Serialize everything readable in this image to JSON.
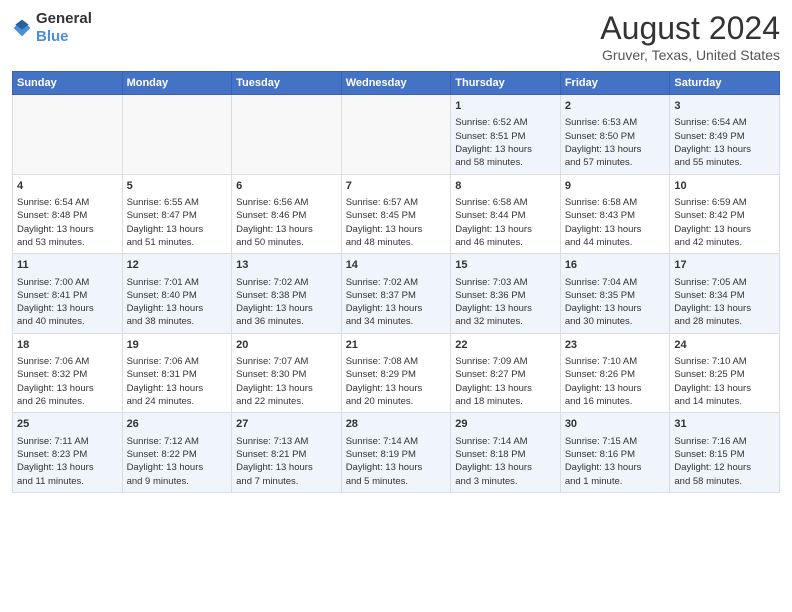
{
  "header": {
    "logo_general": "General",
    "logo_blue": "Blue",
    "month_year": "August 2024",
    "location": "Gruver, Texas, United States"
  },
  "days_of_week": [
    "Sunday",
    "Monday",
    "Tuesday",
    "Wednesday",
    "Thursday",
    "Friday",
    "Saturday"
  ],
  "weeks": [
    [
      {
        "day": "",
        "content": ""
      },
      {
        "day": "",
        "content": ""
      },
      {
        "day": "",
        "content": ""
      },
      {
        "day": "",
        "content": ""
      },
      {
        "day": "1",
        "content": "Sunrise: 6:52 AM\nSunset: 8:51 PM\nDaylight: 13 hours\nand 58 minutes."
      },
      {
        "day": "2",
        "content": "Sunrise: 6:53 AM\nSunset: 8:50 PM\nDaylight: 13 hours\nand 57 minutes."
      },
      {
        "day": "3",
        "content": "Sunrise: 6:54 AM\nSunset: 8:49 PM\nDaylight: 13 hours\nand 55 minutes."
      }
    ],
    [
      {
        "day": "4",
        "content": "Sunrise: 6:54 AM\nSunset: 8:48 PM\nDaylight: 13 hours\nand 53 minutes."
      },
      {
        "day": "5",
        "content": "Sunrise: 6:55 AM\nSunset: 8:47 PM\nDaylight: 13 hours\nand 51 minutes."
      },
      {
        "day": "6",
        "content": "Sunrise: 6:56 AM\nSunset: 8:46 PM\nDaylight: 13 hours\nand 50 minutes."
      },
      {
        "day": "7",
        "content": "Sunrise: 6:57 AM\nSunset: 8:45 PM\nDaylight: 13 hours\nand 48 minutes."
      },
      {
        "day": "8",
        "content": "Sunrise: 6:58 AM\nSunset: 8:44 PM\nDaylight: 13 hours\nand 46 minutes."
      },
      {
        "day": "9",
        "content": "Sunrise: 6:58 AM\nSunset: 8:43 PM\nDaylight: 13 hours\nand 44 minutes."
      },
      {
        "day": "10",
        "content": "Sunrise: 6:59 AM\nSunset: 8:42 PM\nDaylight: 13 hours\nand 42 minutes."
      }
    ],
    [
      {
        "day": "11",
        "content": "Sunrise: 7:00 AM\nSunset: 8:41 PM\nDaylight: 13 hours\nand 40 minutes."
      },
      {
        "day": "12",
        "content": "Sunrise: 7:01 AM\nSunset: 8:40 PM\nDaylight: 13 hours\nand 38 minutes."
      },
      {
        "day": "13",
        "content": "Sunrise: 7:02 AM\nSunset: 8:38 PM\nDaylight: 13 hours\nand 36 minutes."
      },
      {
        "day": "14",
        "content": "Sunrise: 7:02 AM\nSunset: 8:37 PM\nDaylight: 13 hours\nand 34 minutes."
      },
      {
        "day": "15",
        "content": "Sunrise: 7:03 AM\nSunset: 8:36 PM\nDaylight: 13 hours\nand 32 minutes."
      },
      {
        "day": "16",
        "content": "Sunrise: 7:04 AM\nSunset: 8:35 PM\nDaylight: 13 hours\nand 30 minutes."
      },
      {
        "day": "17",
        "content": "Sunrise: 7:05 AM\nSunset: 8:34 PM\nDaylight: 13 hours\nand 28 minutes."
      }
    ],
    [
      {
        "day": "18",
        "content": "Sunrise: 7:06 AM\nSunset: 8:32 PM\nDaylight: 13 hours\nand 26 minutes."
      },
      {
        "day": "19",
        "content": "Sunrise: 7:06 AM\nSunset: 8:31 PM\nDaylight: 13 hours\nand 24 minutes."
      },
      {
        "day": "20",
        "content": "Sunrise: 7:07 AM\nSunset: 8:30 PM\nDaylight: 13 hours\nand 22 minutes."
      },
      {
        "day": "21",
        "content": "Sunrise: 7:08 AM\nSunset: 8:29 PM\nDaylight: 13 hours\nand 20 minutes."
      },
      {
        "day": "22",
        "content": "Sunrise: 7:09 AM\nSunset: 8:27 PM\nDaylight: 13 hours\nand 18 minutes."
      },
      {
        "day": "23",
        "content": "Sunrise: 7:10 AM\nSunset: 8:26 PM\nDaylight: 13 hours\nand 16 minutes."
      },
      {
        "day": "24",
        "content": "Sunrise: 7:10 AM\nSunset: 8:25 PM\nDaylight: 13 hours\nand 14 minutes."
      }
    ],
    [
      {
        "day": "25",
        "content": "Sunrise: 7:11 AM\nSunset: 8:23 PM\nDaylight: 13 hours\nand 11 minutes."
      },
      {
        "day": "26",
        "content": "Sunrise: 7:12 AM\nSunset: 8:22 PM\nDaylight: 13 hours\nand 9 minutes."
      },
      {
        "day": "27",
        "content": "Sunrise: 7:13 AM\nSunset: 8:21 PM\nDaylight: 13 hours\nand 7 minutes."
      },
      {
        "day": "28",
        "content": "Sunrise: 7:14 AM\nSunset: 8:19 PM\nDaylight: 13 hours\nand 5 minutes."
      },
      {
        "day": "29",
        "content": "Sunrise: 7:14 AM\nSunset: 8:18 PM\nDaylight: 13 hours\nand 3 minutes."
      },
      {
        "day": "30",
        "content": "Sunrise: 7:15 AM\nSunset: 8:16 PM\nDaylight: 13 hours\nand 1 minute."
      },
      {
        "day": "31",
        "content": "Sunrise: 7:16 AM\nSunset: 8:15 PM\nDaylight: 12 hours\nand 58 minutes."
      }
    ]
  ]
}
